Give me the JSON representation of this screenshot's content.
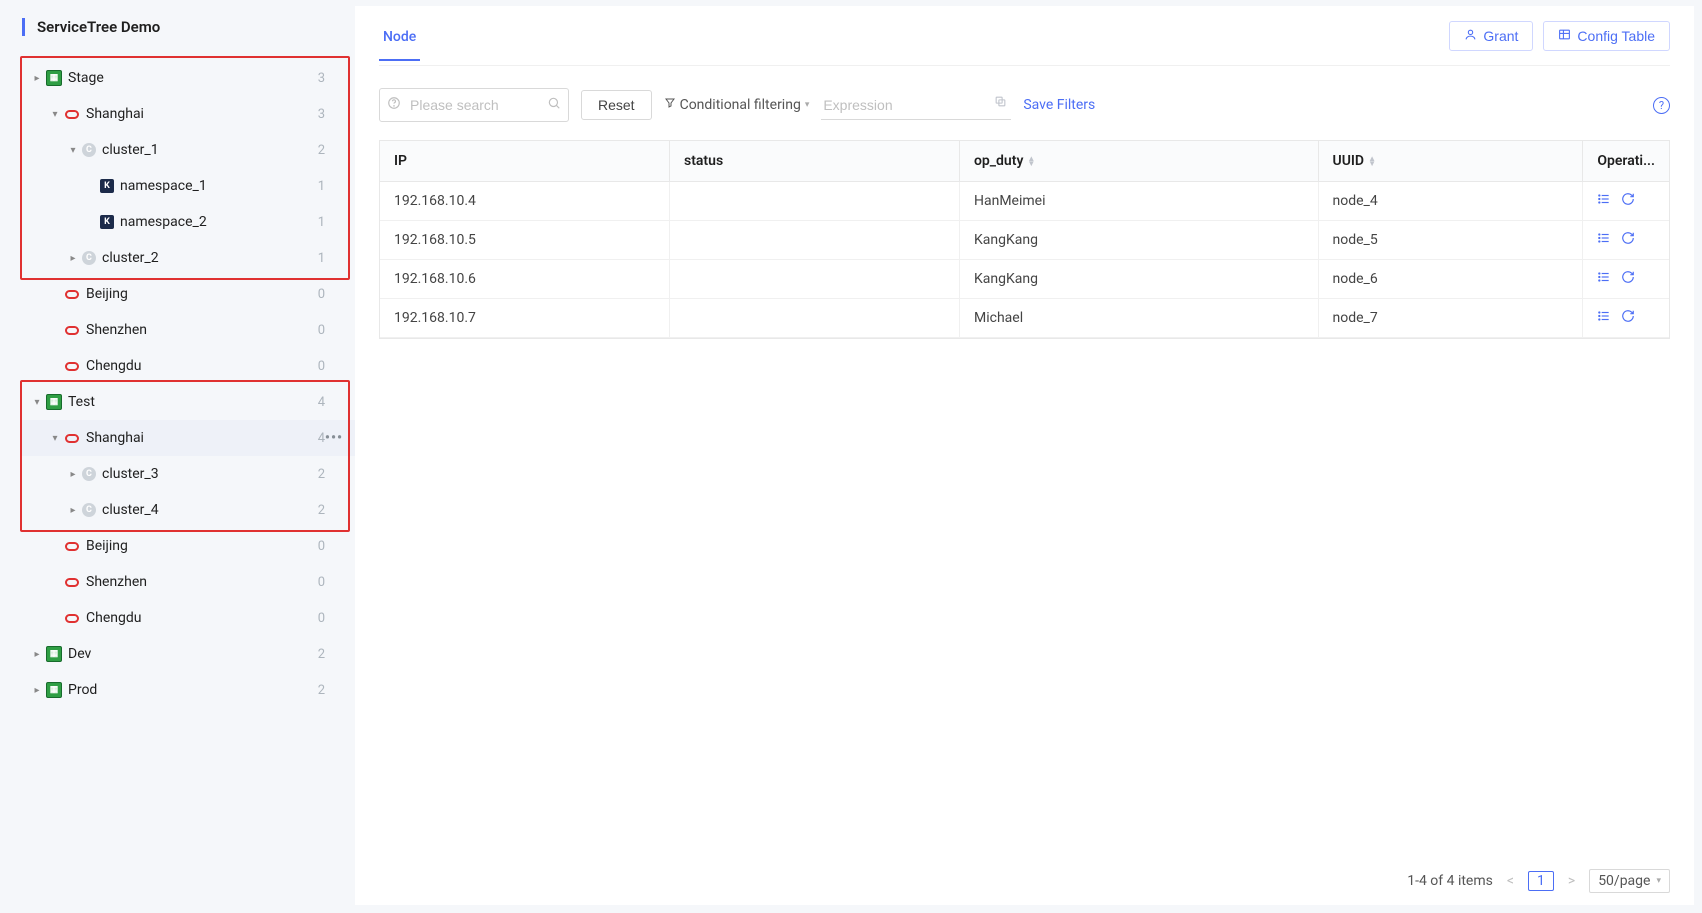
{
  "sidebar": {
    "title": "ServiceTree Demo",
    "tree": [
      {
        "label": "Stage",
        "count": "3",
        "icon": "stage",
        "indent": 0,
        "caret": "right",
        "hl": 1
      },
      {
        "label": "Shanghai",
        "count": "3",
        "icon": "region",
        "indent": 1,
        "caret": "down",
        "hl": 1
      },
      {
        "label": "cluster_1",
        "count": "2",
        "icon": "cluster",
        "indent": 2,
        "caret": "down",
        "hl": 1
      },
      {
        "label": "namespace_1",
        "count": "1",
        "icon": "ns",
        "indent": 3,
        "caret": "none",
        "hl": 1
      },
      {
        "label": "namespace_2",
        "count": "1",
        "icon": "ns",
        "indent": 3,
        "caret": "none",
        "hl": 1
      },
      {
        "label": "cluster_2",
        "count": "1",
        "icon": "cluster",
        "indent": 2,
        "caret": "right",
        "hl": 1
      },
      {
        "label": "Beijing",
        "count": "0",
        "icon": "region",
        "indent": 1,
        "caret": "none"
      },
      {
        "label": "Shenzhen",
        "count": "0",
        "icon": "region",
        "indent": 1,
        "caret": "none"
      },
      {
        "label": "Chengdu",
        "count": "0",
        "icon": "region",
        "indent": 1,
        "caret": "none"
      },
      {
        "label": "Test",
        "count": "4",
        "icon": "stage",
        "indent": 0,
        "caret": "down",
        "hl": 2
      },
      {
        "label": "Shanghai",
        "count": "4",
        "icon": "region",
        "indent": 1,
        "caret": "down",
        "selected": true,
        "more": true,
        "hl": 2
      },
      {
        "label": "cluster_3",
        "count": "2",
        "icon": "cluster",
        "indent": 2,
        "caret": "right",
        "hl": 2
      },
      {
        "label": "cluster_4",
        "count": "2",
        "icon": "cluster",
        "indent": 2,
        "caret": "right",
        "hl": 2
      },
      {
        "label": "Beijing",
        "count": "0",
        "icon": "region",
        "indent": 1,
        "caret": "none"
      },
      {
        "label": "Shenzhen",
        "count": "0",
        "icon": "region",
        "indent": 1,
        "caret": "none"
      },
      {
        "label": "Chengdu",
        "count": "0",
        "icon": "region",
        "indent": 1,
        "caret": "none"
      },
      {
        "label": "Dev",
        "count": "2",
        "icon": "stage",
        "indent": 0,
        "caret": "right"
      },
      {
        "label": "Prod",
        "count": "2",
        "icon": "stage",
        "indent": 0,
        "caret": "right"
      }
    ]
  },
  "topbar": {
    "tabs": [
      {
        "label": "Node",
        "active": true
      }
    ],
    "grant_label": "Grant",
    "config_label": "Config Table"
  },
  "filters": {
    "search_placeholder": "Please search",
    "reset_label": "Reset",
    "cond_label": "Conditional filtering",
    "expr_placeholder": "Expression",
    "save_label": "Save Filters"
  },
  "table": {
    "columns": [
      "IP",
      "status",
      "op_duty",
      "UUID",
      "Operati..."
    ],
    "sortable": [
      false,
      false,
      true,
      true,
      false
    ],
    "rows": [
      {
        "ip": "192.168.10.4",
        "status": "",
        "op_duty": "HanMeimei",
        "uuid": "node_4"
      },
      {
        "ip": "192.168.10.5",
        "status": "",
        "op_duty": "KangKang",
        "uuid": "node_5"
      },
      {
        "ip": "192.168.10.6",
        "status": "",
        "op_duty": "KangKang",
        "uuid": "node_6"
      },
      {
        "ip": "192.168.10.7",
        "status": "",
        "op_duty": "Michael",
        "uuid": "node_7"
      }
    ]
  },
  "pager": {
    "summary": "1-4 of 4 items",
    "page": "1",
    "size": "50/page"
  }
}
